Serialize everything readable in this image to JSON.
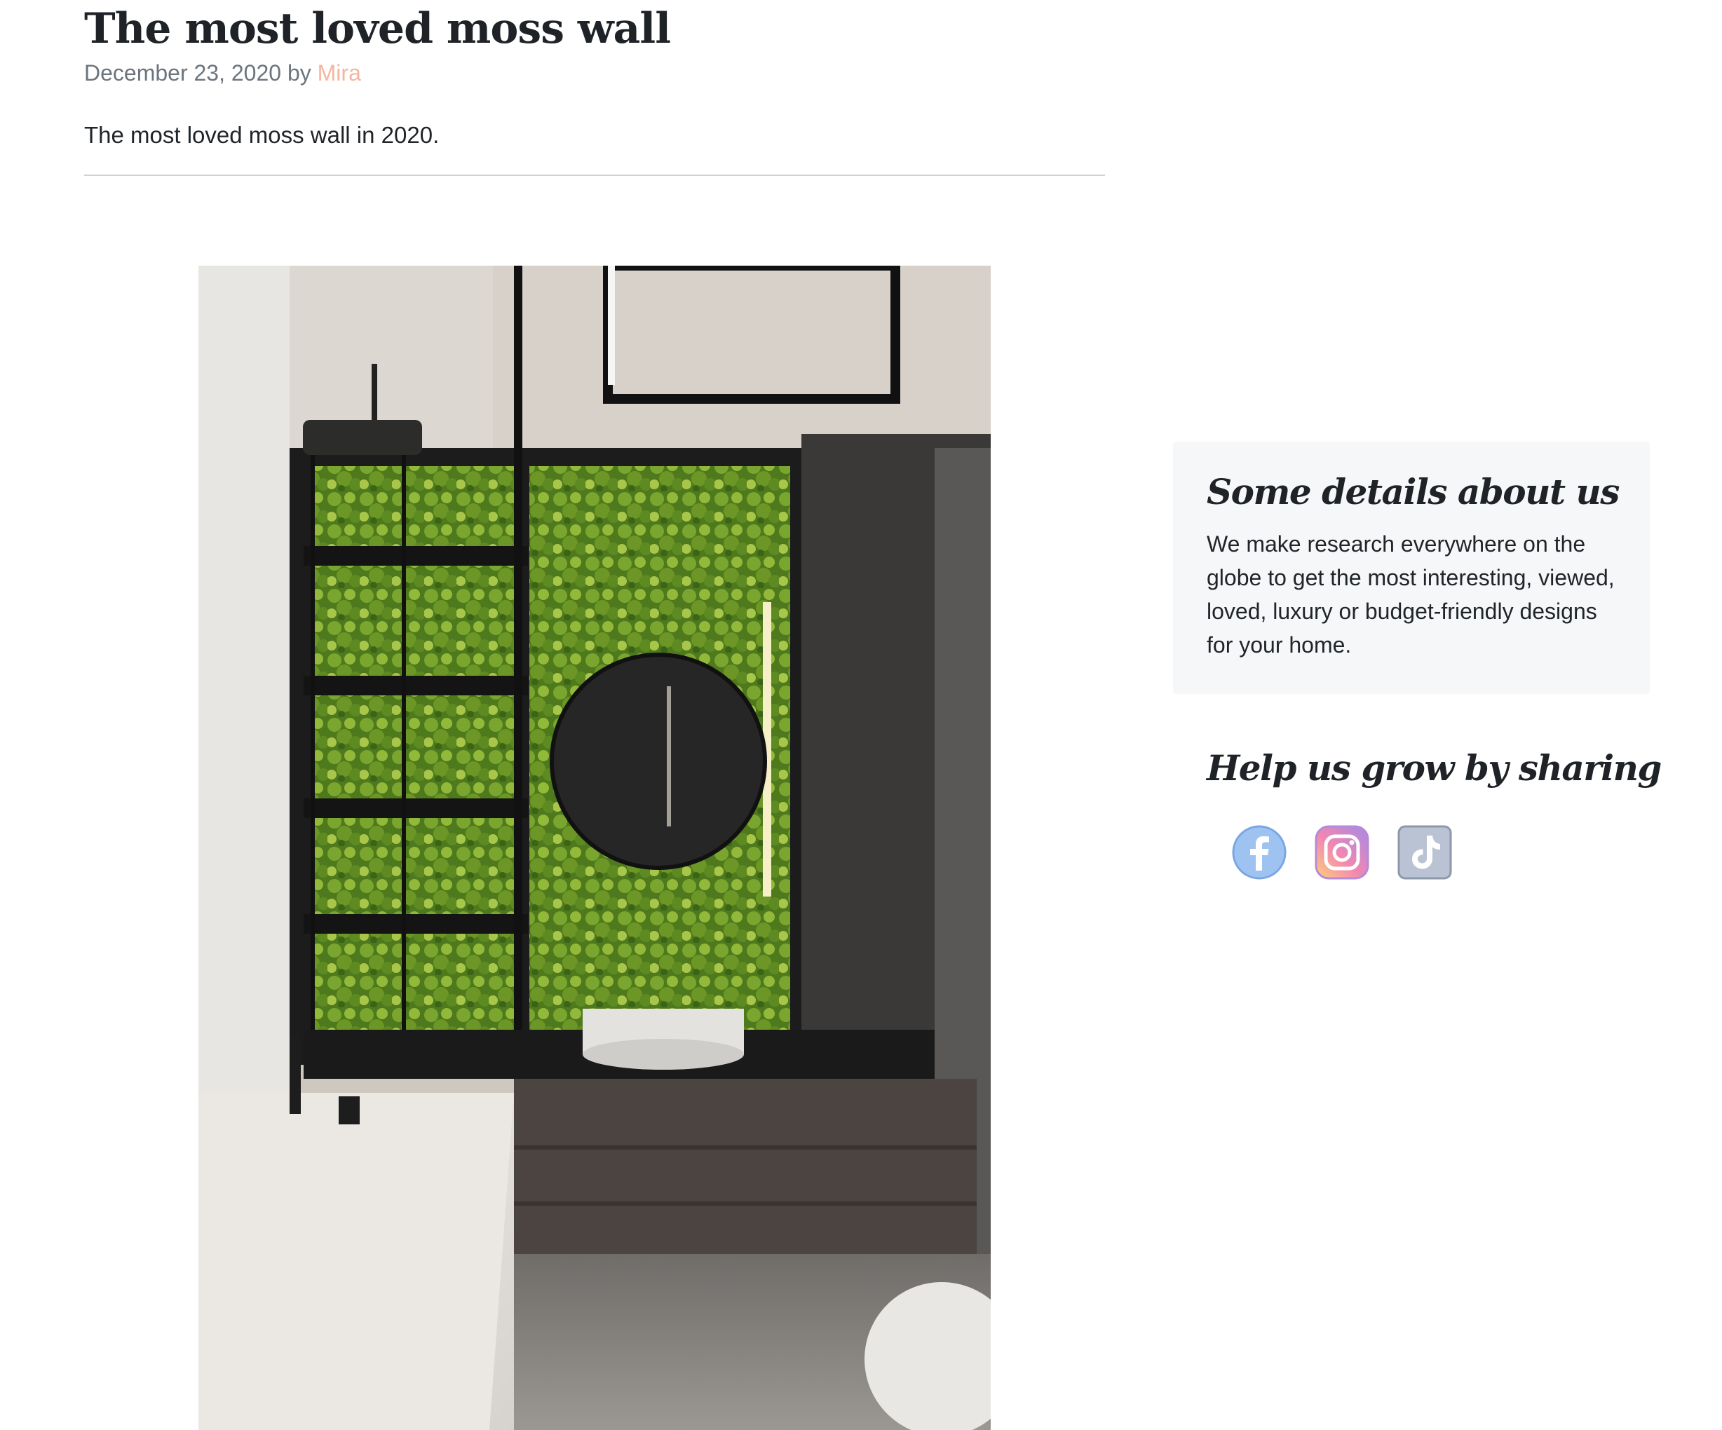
{
  "post": {
    "title": "The most loved moss wall",
    "date_prefix": "December 23, 2020 by ",
    "author": "Mira",
    "summary": "The most loved moss wall in 2020."
  },
  "hero_image": {
    "description": "bathroom-with-moss-wall-photo"
  },
  "sidebar": {
    "about": {
      "title": "Some details about us",
      "text": "We make research everywhere on the globe to get the most interesting, viewed, loved, luxury or budget-friendly designs for your home."
    },
    "share": {
      "title": "Help us grow by sharing",
      "icons": [
        "facebook-icon",
        "instagram-icon",
        "tiktok-icon"
      ]
    }
  },
  "colors": {
    "author_link": "#f4b6a1",
    "about_bg": "#f6f7f9",
    "moss": "#5f8a22"
  }
}
